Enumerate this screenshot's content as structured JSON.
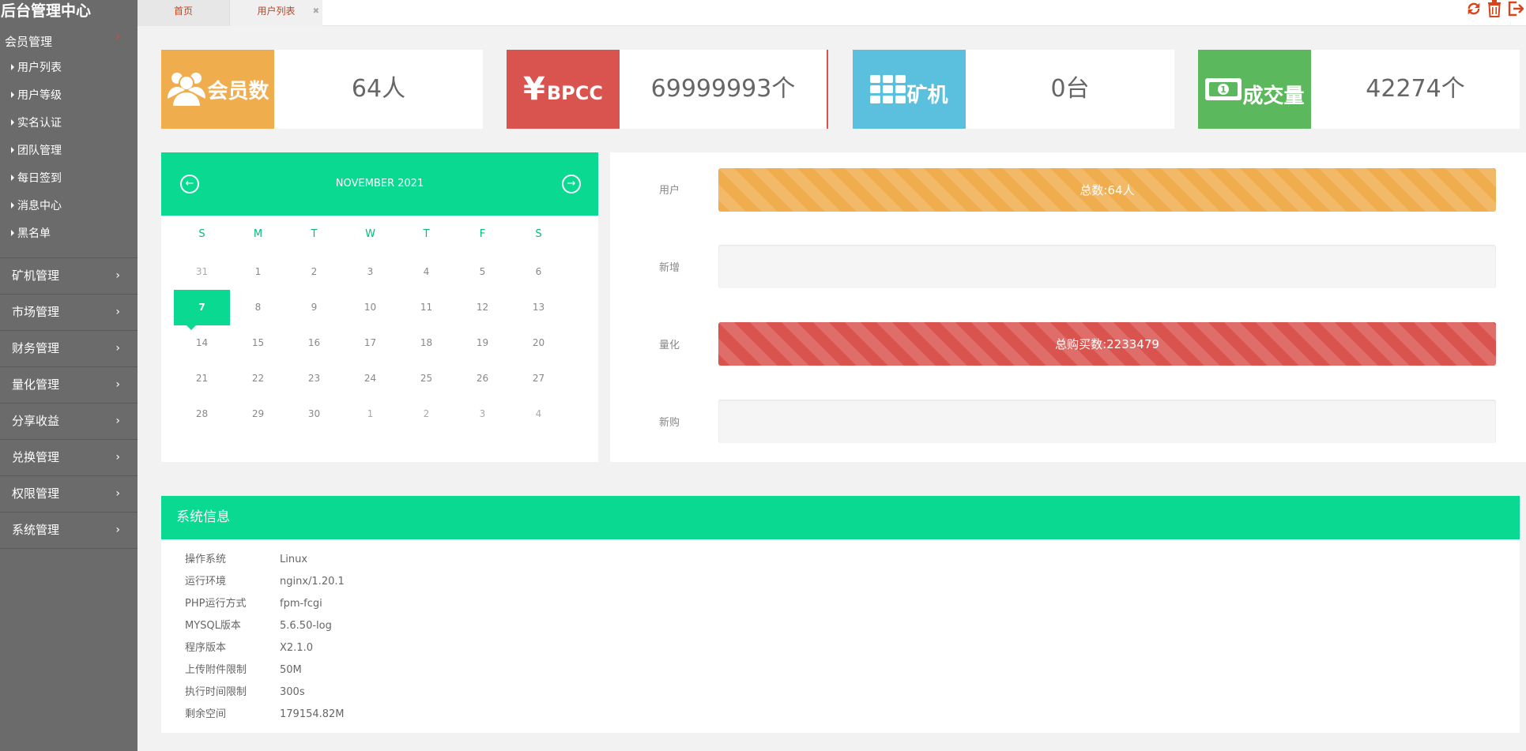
{
  "sidebar": {
    "brand": "后台管理中心",
    "groups": [
      {
        "label": "会员管理",
        "expanded": true,
        "items": [
          "用户列表",
          "用户等级",
          "实名认证",
          "团队管理",
          "每日签到",
          "消息中心",
          "黑名单"
        ]
      },
      {
        "label": "矿机管理"
      },
      {
        "label": "市场管理"
      },
      {
        "label": "财务管理"
      },
      {
        "label": "量化管理"
      },
      {
        "label": "分享收益"
      },
      {
        "label": "兑换管理"
      },
      {
        "label": "权限管理"
      },
      {
        "label": "系统管理"
      }
    ]
  },
  "tabs": {
    "home": "首页",
    "users": "用户列表"
  },
  "top_icons": [
    "refresh-icon",
    "trash-icon",
    "logout-icon"
  ],
  "stats": [
    {
      "label": "会员数",
      "value": "64人",
      "color": "#f0ad4e",
      "icon": "users-icon"
    },
    {
      "label": "BPCC",
      "prefix": "¥",
      "value": "69999993个",
      "color": "#d9534f",
      "icon": "yen-icon"
    },
    {
      "label": "矿机",
      "value": "0台",
      "color": "#5bc0de",
      "icon": "grid-icon"
    },
    {
      "label": "成交量",
      "value": "42274个",
      "color": "#5cb85c",
      "icon": "money-icon"
    }
  ],
  "calendar": {
    "month": "NOVEMBER 2021",
    "dow": [
      "S",
      "M",
      "T",
      "W",
      "T",
      "F",
      "S"
    ],
    "weeks": [
      [
        "31",
        "1",
        "2",
        "3",
        "4",
        "5",
        "6"
      ],
      [
        "7",
        "8",
        "9",
        "10",
        "11",
        "12",
        "13"
      ],
      [
        "14",
        "15",
        "16",
        "17",
        "18",
        "19",
        "20"
      ],
      [
        "21",
        "22",
        "23",
        "24",
        "25",
        "26",
        "27"
      ],
      [
        "28",
        "29",
        "30",
        "1",
        "2",
        "3",
        "4"
      ]
    ],
    "selected": "7"
  },
  "progress": [
    {
      "label": "用户",
      "text": "总数:64人",
      "percent": 100,
      "color": "orange"
    },
    {
      "label": "新增",
      "text": "",
      "percent": 0,
      "color": "orange"
    },
    {
      "label": "量化",
      "text": "总购买数:2233479",
      "percent": 100,
      "color": "red"
    },
    {
      "label": "新购",
      "text": "",
      "percent": 0,
      "color": "red"
    }
  ],
  "system": {
    "title": "系统信息",
    "rows": [
      {
        "key": "操作系统",
        "value": "Linux"
      },
      {
        "key": "运行环境",
        "value": "nginx/1.20.1"
      },
      {
        "key": "PHP运行方式",
        "value": "fpm-fcgi"
      },
      {
        "key": "MYSQL版本",
        "value": "5.6.50-log"
      },
      {
        "key": "程序版本",
        "value": "X2.1.0"
      },
      {
        "key": "上传附件限制",
        "value": "50M"
      },
      {
        "key": "执行时间限制",
        "value": "300s"
      },
      {
        "key": "剩余空间",
        "value": "179154.82M"
      }
    ]
  }
}
